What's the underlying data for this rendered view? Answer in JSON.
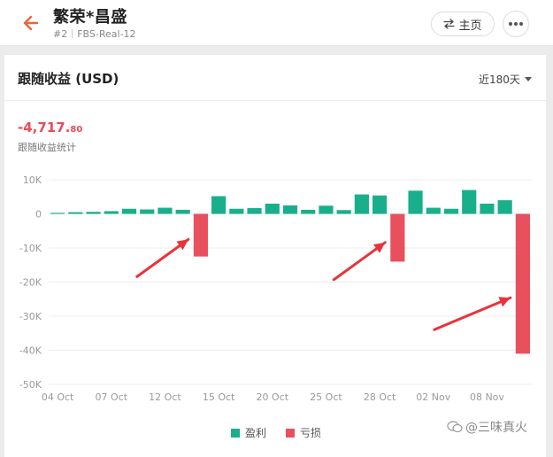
{
  "header": {
    "title": "繁荣*昌盛",
    "rank": "#2",
    "account": "FBS-Real-12",
    "home_label": "主页",
    "back_icon": "arrow-left-icon",
    "more_icon": "more-horizontal-icon",
    "accent_color": "#e8683a"
  },
  "card": {
    "title": "跟随收益 (USD)",
    "range_label": "近180天",
    "total_main": "-4,717.",
    "total_decimal": "80",
    "total_label": "跟随收益统计"
  },
  "legend": {
    "profit_label": "盈利",
    "loss_label": "亏损",
    "profit_color": "#1aaf8b",
    "loss_color": "#e8505e"
  },
  "watermark": {
    "text": "@三味真火"
  },
  "chart_data": {
    "type": "bar",
    "ylim": [
      -50000,
      10000
    ],
    "yticks": [
      10000,
      0,
      -10000,
      -20000,
      -30000,
      -40000,
      -50000
    ],
    "ytick_labels": [
      "10K",
      "0",
      "-10K",
      "-20K",
      "-30K",
      "-40K",
      "-50K"
    ],
    "xtick_labels": [
      "04 Oct",
      "07 Oct",
      "12 Oct",
      "15 Oct",
      "20 Oct",
      "25 Oct",
      "28 Oct",
      "02 Nov",
      "08 Nov"
    ],
    "xtick_bar_index": [
      0,
      3,
      6,
      9,
      12,
      15,
      18,
      21,
      24
    ],
    "values": [
      300,
      500,
      600,
      800,
      1500,
      1300,
      1800,
      1200,
      -12500,
      5200,
      1500,
      1700,
      3000,
      2500,
      1200,
      2400,
      1100,
      5700,
      5400,
      -14000,
      6800,
      1800,
      1500,
      7000,
      3000,
      4000,
      -41000
    ],
    "grid": true
  }
}
